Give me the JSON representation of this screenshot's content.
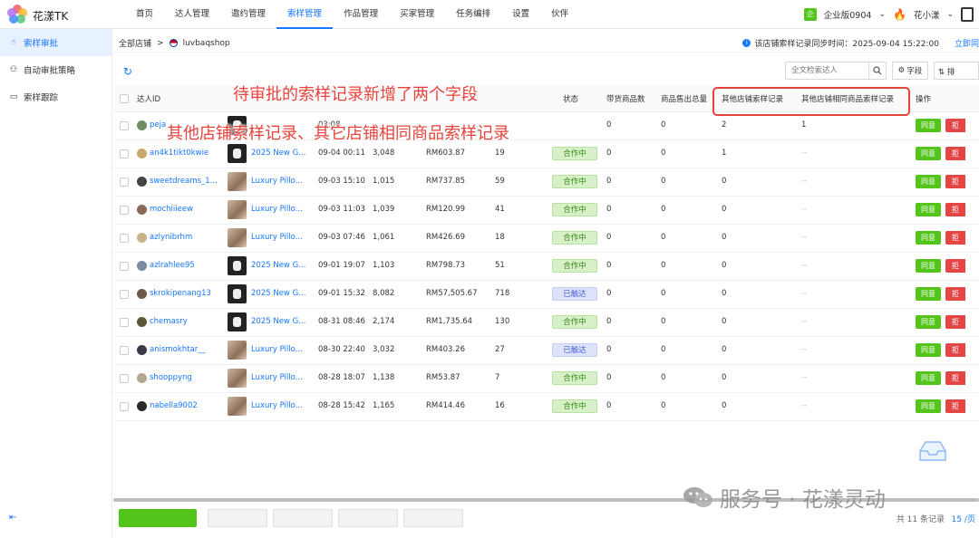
{
  "app": {
    "brand": "花漾TK"
  },
  "nav": {
    "items": [
      "首页",
      "达人管理",
      "邀约管理",
      "索样管理",
      "作品管理",
      "买家管理",
      "任务编排",
      "设置",
      "伙伴"
    ],
    "active_index": 3
  },
  "topright": {
    "edition_badge": "企",
    "edition": "企业版0904",
    "user": "花小漾"
  },
  "sidebar": {
    "items": [
      {
        "label": "索样审批",
        "icon": "hand-pointer-icon",
        "active": true
      },
      {
        "label": "自动审批策略",
        "icon": "user-settings-icon",
        "active": false
      },
      {
        "label": "索样跟踪",
        "icon": "tracking-icon",
        "active": false
      }
    ]
  },
  "breadcrumb": {
    "root": "全部店铺",
    "separator": ">",
    "shop": "luvbaqshop"
  },
  "sync": {
    "text": "该店铺索样记录同步时间：2025-09-04 15:22:00",
    "link": "立即同"
  },
  "toolbar": {
    "search_placeholder": "全文检索达人",
    "fields_label": "字段",
    "sort_label": "排"
  },
  "table": {
    "headers": {
      "creator_id": "达人ID",
      "status": "状态",
      "products_promoted": "带货商品数",
      "items_sold": "商品售出总量",
      "other_shop_records": "其他店铺索样记录",
      "other_shop_same_product_records": "其他店铺相同商品索样记录",
      "actions": "操作"
    },
    "rows": [
      {
        "creator": "peja",
        "avatar_color": "#6b8f5e",
        "thumb": "dark",
        "product": "",
        "time": "03:08",
        "videos": "",
        "gmv": "",
        "orders": "",
        "status": "",
        "status_type": "",
        "products_promoted": "0",
        "items_sold": "0",
        "other_shop": "2",
        "other_same": "1"
      },
      {
        "creator": "an4k1tikt0kwie",
        "avatar_color": "#c9a86b",
        "thumb": "dark",
        "product": "2025 New G...",
        "time": "09-04 00:11",
        "videos": "3,048",
        "gmv": "RM603.87",
        "orders": "19",
        "status": "合作中",
        "status_type": "coop",
        "products_promoted": "0",
        "items_sold": "0",
        "other_shop": "1",
        "other_same": "--"
      },
      {
        "creator": "sweetdreams_1...",
        "avatar_color": "#444444",
        "thumb": "pillow",
        "product": "Luxury Pillo...",
        "time": "09-03 15:10",
        "videos": "1,015",
        "gmv": "RM737.85",
        "orders": "59",
        "status": "合作中",
        "status_type": "coop",
        "products_promoted": "0",
        "items_sold": "0",
        "other_shop": "0",
        "other_same": "--"
      },
      {
        "creator": "mochiiieew",
        "avatar_color": "#8c6a5a",
        "thumb": "pillow",
        "product": "Luxury Pillo...",
        "time": "09-03 11:03",
        "videos": "1,039",
        "gmv": "RM120.99",
        "orders": "41",
        "status": "合作中",
        "status_type": "coop",
        "products_promoted": "0",
        "items_sold": "0",
        "other_shop": "0",
        "other_same": "--"
      },
      {
        "creator": "azlynibrhm",
        "avatar_color": "#c9b48a",
        "thumb": "pillow",
        "product": "Luxury Pillo...",
        "time": "09-03 07:46",
        "videos": "1,061",
        "gmv": "RM426.69",
        "orders": "18",
        "status": "合作中",
        "status_type": "coop",
        "products_promoted": "0",
        "items_sold": "0",
        "other_shop": "0",
        "other_same": "--"
      },
      {
        "creator": "azlrahlee95",
        "avatar_color": "#7a8aa0",
        "thumb": "dark",
        "product": "2025 New G...",
        "time": "09-01 19:07",
        "videos": "1,103",
        "gmv": "RM798.73",
        "orders": "51",
        "status": "合作中",
        "status_type": "coop",
        "products_promoted": "0",
        "items_sold": "0",
        "other_shop": "0",
        "other_same": "--"
      },
      {
        "creator": "skrokipenang13",
        "avatar_color": "#6e5a48",
        "thumb": "dark",
        "product": "2025 New G...",
        "time": "09-01 15:32",
        "videos": "8,082",
        "gmv": "RM57,505.67",
        "orders": "718",
        "status": "已触达",
        "status_type": "reached",
        "products_promoted": "0",
        "items_sold": "0",
        "other_shop": "0",
        "other_same": "--"
      },
      {
        "creator": "chemasry",
        "avatar_color": "#5a5a3a",
        "thumb": "dark",
        "product": "2025 New G...",
        "time": "08-31 08:46",
        "videos": "2,174",
        "gmv": "RM1,735.64",
        "orders": "130",
        "status": "合作中",
        "status_type": "coop",
        "products_promoted": "0",
        "items_sold": "0",
        "other_shop": "0",
        "other_same": "--"
      },
      {
        "creator": "anismokhtar__",
        "avatar_color": "#3a3a4a",
        "thumb": "pillow",
        "product": "Luxury Pillo...",
        "time": "08-30 22:40",
        "videos": "3,032",
        "gmv": "RM403.26",
        "orders": "27",
        "status": "已触达",
        "status_type": "reached",
        "products_promoted": "0",
        "items_sold": "0",
        "other_shop": "0",
        "other_same": "--"
      },
      {
        "creator": "shooppyng",
        "avatar_color": "#b0a890",
        "thumb": "pillow",
        "product": "Luxury Pillo...",
        "time": "08-28 18:07",
        "videos": "1,138",
        "gmv": "RM53.87",
        "orders": "7",
        "status": "合作中",
        "status_type": "coop",
        "products_promoted": "0",
        "items_sold": "0",
        "other_shop": "0",
        "other_same": "--"
      },
      {
        "creator": "nabella9002",
        "avatar_color": "#2a2a2a",
        "thumb": "pillow",
        "product": "Luxury Pillo...",
        "time": "08-28 15:42",
        "videos": "1,165",
        "gmv": "RM414.46",
        "orders": "16",
        "status": "合作中",
        "status_type": "coop",
        "products_promoted": "0",
        "items_sold": "0",
        "other_shop": "0",
        "other_same": "--"
      }
    ],
    "approve_label": "同意",
    "reject_label": "拒"
  },
  "annotation": {
    "line1": "待审批的索样记录新增了两个字段",
    "line2": "其他店铺索样记录、其它店铺相同商品索样记录"
  },
  "footer": {
    "total_text": "共 11 条记录",
    "page_size": "15 /页"
  },
  "watermark": {
    "text": "服务号 · 花漾灵动"
  },
  "colors": {
    "accent": "#1677ff",
    "approve": "#52c41a",
    "reject": "#e64545",
    "annotation": "#e8423b"
  }
}
